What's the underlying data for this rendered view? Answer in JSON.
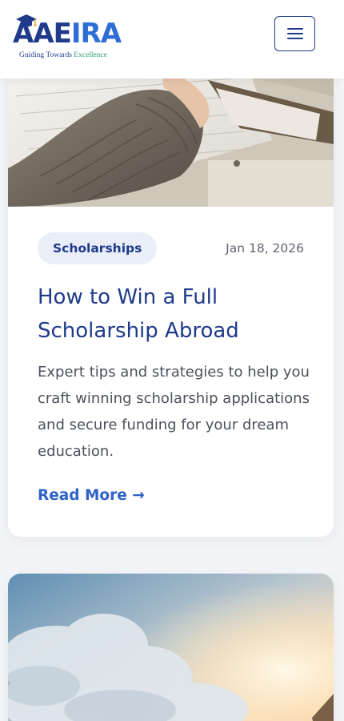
{
  "header": {
    "logo": {
      "word_aa": "AA",
      "word_e": "E",
      "word_ira": "IRA",
      "tagline_main": "Guiding Towards ",
      "tagline_accent": "Excellence"
    },
    "menu_icon": "hamburger-menu-icon"
  },
  "posts": [
    {
      "category": "Scholarships",
      "date": "Jan 18, 2026",
      "title": "How to Win a Full Scholarship Abroad",
      "excerpt": "Expert tips and strategies to help you craft winning scholarship applications and secure funding for your dream education.",
      "read_more": "Read More →",
      "image": "person-writing-at-desk-photo"
    },
    {
      "image": "sky-clouds-sunrise-photo"
    }
  ],
  "colors": {
    "brand_navy": "#1f3a8a",
    "brand_blue": "#2f62c8",
    "accent_green": "#2aa36b",
    "badge_bg": "#e9eef9",
    "page_bg": "#f3f4f7"
  }
}
